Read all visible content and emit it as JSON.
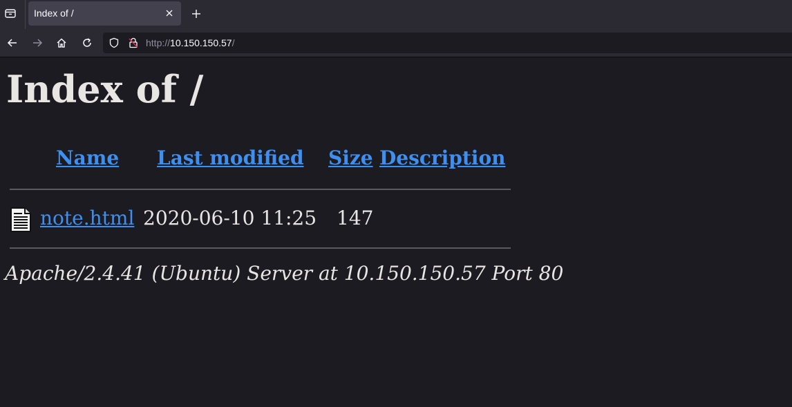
{
  "browser": {
    "tab": {
      "title": "Index of /"
    },
    "url": {
      "scheme": "http://",
      "host": "10.150.150.57",
      "path": "/"
    }
  },
  "page": {
    "heading": "Index of /",
    "columns": {
      "name": "Name",
      "last_modified": "Last modified",
      "size": "Size",
      "description": "Description"
    },
    "rows": [
      {
        "icon": "text-file-icon",
        "name": "note.html",
        "last_modified": "2020-06-10 11:25",
        "size": "147",
        "description": ""
      }
    ],
    "address": "Apache/2.4.41 (Ubuntu) Server at 10.150.150.57 Port 80"
  },
  "colors": {
    "chrome_bg": "#2b2a33",
    "active_tab": "#42414d",
    "page_bg": "#1c1b22",
    "link": "#3f8ff0",
    "text": "#e8e6e3"
  }
}
